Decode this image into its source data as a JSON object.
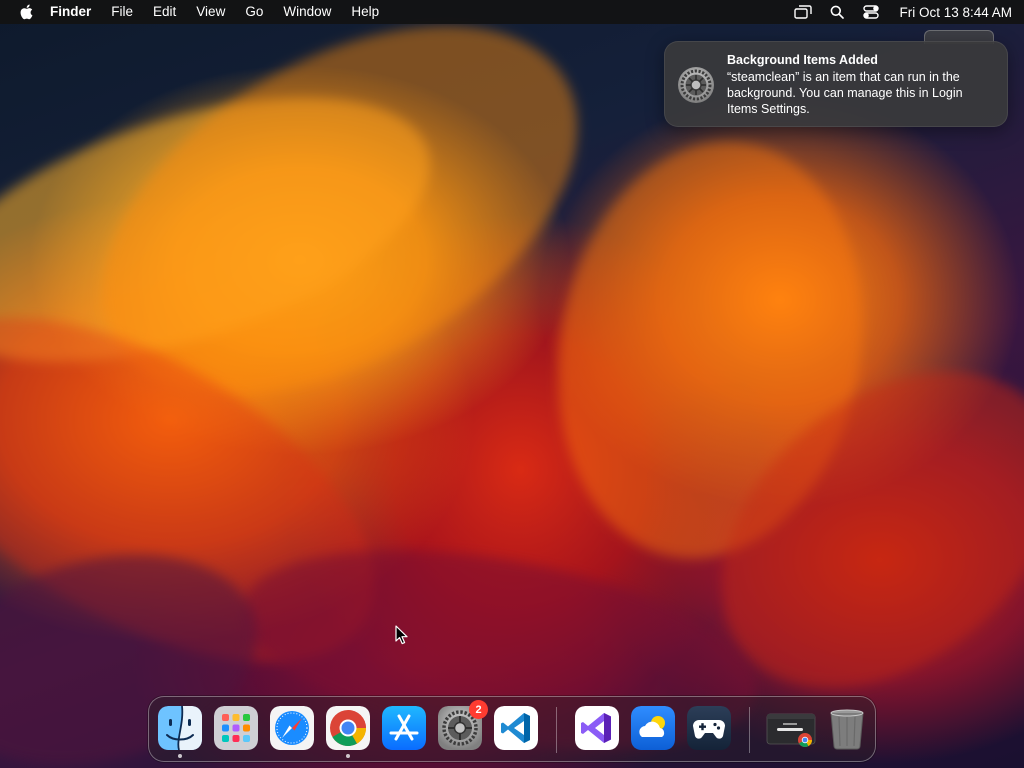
{
  "menubar": {
    "apple_icon": "apple-logo-icon",
    "app_name": "Finder",
    "menus": [
      "File",
      "Edit",
      "View",
      "Go",
      "Window",
      "Help"
    ],
    "status_icons": [
      "screen-mirroring-icon",
      "spotlight-search-icon",
      "control-center-icon"
    ],
    "clock": "Fri Oct 13  8:44 AM"
  },
  "notification": {
    "icon": "system-settings-icon",
    "title": "Background Items Added",
    "body": "“steamclean” is an item that can run in the background. You can manage this in Login Items Settings."
  },
  "dock": {
    "apps": [
      {
        "name": "Finder",
        "icon": "finder-icon",
        "running": true
      },
      {
        "name": "Launchpad",
        "icon": "launchpad-icon",
        "running": false
      },
      {
        "name": "Safari",
        "icon": "safari-icon",
        "running": false
      },
      {
        "name": "Google Chrome",
        "icon": "chrome-icon",
        "running": true
      },
      {
        "name": "App Store",
        "icon": "app-store-icon",
        "running": false
      },
      {
        "name": "System Settings",
        "icon": "system-settings-icon",
        "running": false,
        "badge": "2"
      },
      {
        "name": "Visual Studio Code",
        "icon": "vscode-icon",
        "running": false
      },
      {
        "name": "Visual Studio",
        "icon": "visual-studio-icon",
        "running": false
      },
      {
        "name": "Weather",
        "icon": "weather-icon",
        "running": false
      },
      {
        "name": "Steam Link",
        "icon": "gamepad-icon",
        "running": false
      },
      {
        "name": "Chrome Window",
        "icon": "minimized-window-icon",
        "running": false
      },
      {
        "name": "Trash",
        "icon": "trash-icon",
        "running": false
      }
    ]
  },
  "colors": {
    "menubar_bg": "#121212",
    "notification_bg": "#3a3a3c",
    "badge_red": "#ff3b30",
    "wallpaper_orange": "#ff8a12",
    "wallpaper_dark": "#0e1a2c"
  }
}
